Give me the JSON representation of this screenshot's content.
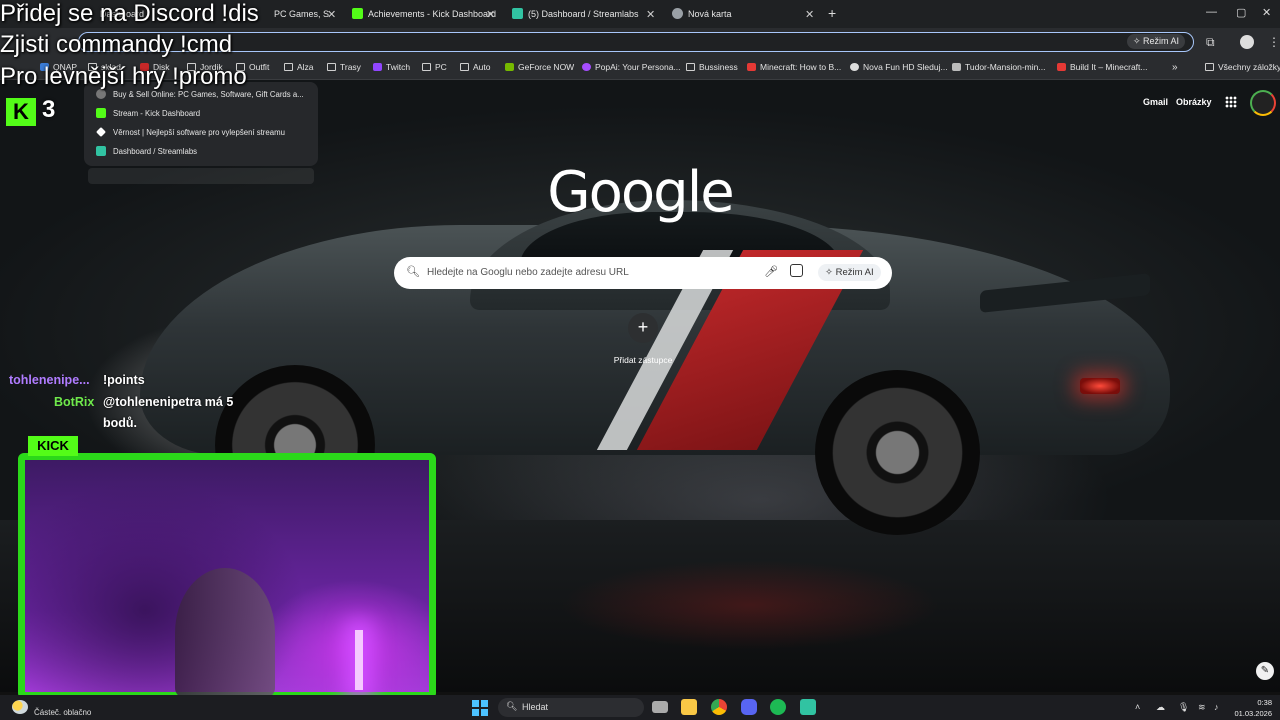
{
  "tabs": [
    {
      "label": "Achievements - Kick Dashboard",
      "color": "#53fc18"
    },
    {
      "label": "(5) Dashboard / Streamlabs",
      "color": "#31c3a2"
    },
    {
      "label": "Nová karta",
      "color": "#9aa0a6"
    }
  ],
  "tabs_partial": {
    "left": "Dashboard",
    "middle": "PC Games, S"
  },
  "omnibox": {
    "ai_mode": "Režim AI"
  },
  "bookmarks": [
    {
      "label": "QNAP"
    },
    {
      "label": "sklad"
    },
    {
      "label": "Disk"
    },
    {
      "label": "Jordik"
    },
    {
      "label": "Outfit"
    },
    {
      "label": "Alza"
    },
    {
      "label": "Trasy"
    },
    {
      "label": "Twitch"
    },
    {
      "label": "PC"
    },
    {
      "label": "Auto"
    },
    {
      "label": "GeForce NOW"
    },
    {
      "label": "PopAi: Your Persona..."
    },
    {
      "label": "Bussiness"
    },
    {
      "label": "Minecraft: How to B..."
    },
    {
      "label": "Nova Fun HD Sleduj..."
    },
    {
      "label": "Tudor-Mansion-min..."
    },
    {
      "label": "Build It – Minecraft..."
    }
  ],
  "bookmarks_all": "Všechny záložky",
  "suggestions": [
    "Buy & Sell Online: PC Games, Software, Gift Cards a...",
    "Stream - Kick Dashboard",
    "Věrnost | Nejlepší software pro vylepšení streamu",
    "Dashboard / Streamlabs"
  ],
  "google": {
    "logo": "Google",
    "gmail": "Gmail",
    "images": "Obrázky",
    "search_placeholder": "Hledejte na Googlu nebo zadejte adresu URL",
    "ai_mode": "Režim AI",
    "add_shortcut": "Přidat zástupce"
  },
  "overlay": {
    "line1": "Přidej se na Discord !dis",
    "line2": "Zjisti commandy !cmd",
    "line3": "Pro levnější hry !promo",
    "kick_logo": "K",
    "kick_count": "3",
    "kick_tag": "KICK"
  },
  "chat": [
    {
      "user": "tohlenenipe...",
      "user_color": "#b07cff",
      "message": "!points"
    },
    {
      "user": "BotRix",
      "user_color": "#6fe94b",
      "message": "@tohlenenipetra má 5",
      "message2": "bodů."
    }
  ],
  "taskbar": {
    "weather": "Částeč. oblačno",
    "search": "Hledat",
    "time": "0:38",
    "date": "01.03.2026"
  },
  "colors": {
    "kick_green": "#53fc18",
    "omnibox_border": "#a8c7fa"
  }
}
